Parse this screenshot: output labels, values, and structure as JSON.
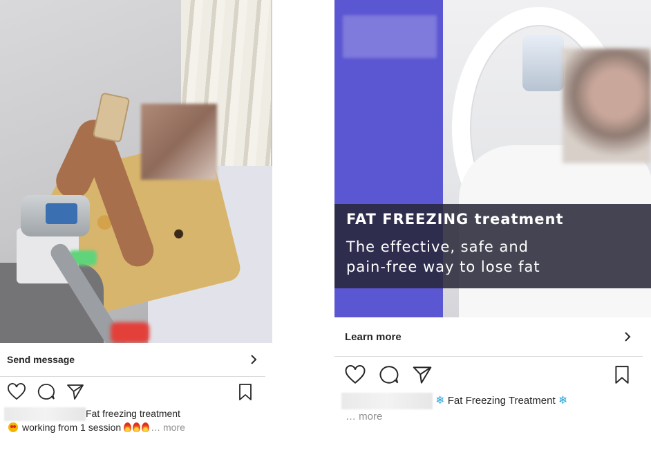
{
  "left_post": {
    "cta_label": "Send message",
    "caption": {
      "title": "Fat freezing treatment",
      "line2_text": "working from 1 session",
      "more_label": "… more"
    },
    "icons": [
      "heart-icon",
      "comment-icon",
      "share-icon",
      "bookmark-icon"
    ]
  },
  "right_post": {
    "overlay": {
      "headline": "FAT FREEZING treatment",
      "sub_line1": "The effective, safe and",
      "sub_line2": "pain-free way to lose fat"
    },
    "cta_label": "Learn more",
    "caption": {
      "title": "Fat Freezing Treatment",
      "more_label": "… more"
    },
    "icons": [
      "heart-icon",
      "comment-icon",
      "share-icon",
      "bookmark-icon"
    ]
  },
  "colors": {
    "accent_purple": "#5b56d2",
    "text_primary": "#262626",
    "text_muted": "#8e8e8e",
    "divider": "#dbdbdb"
  }
}
